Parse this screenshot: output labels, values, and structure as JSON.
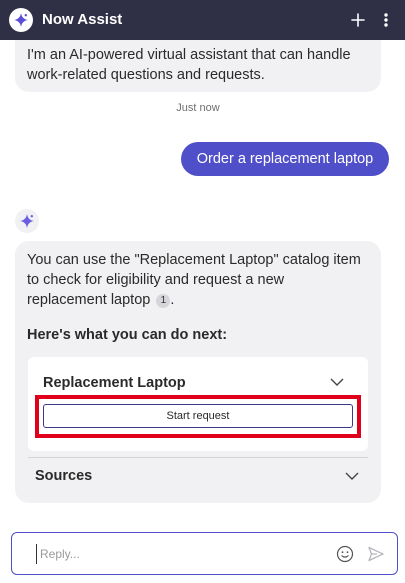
{
  "header": {
    "title": "Now Assist",
    "logo_icon": "sparkle-icon",
    "new_icon": "plus-icon",
    "more_icon": "more-vertical-icon",
    "background": "#2f2f46"
  },
  "messages": {
    "intro_text": "I'm an AI-powered virtual assistant that can handle work-related questions and requests.",
    "timestamp": "Just now",
    "user_message": "Order a replacement laptop",
    "assistant": {
      "icon": "sparkle-icon",
      "text": "You can use the \"Replacement Laptop\" catalog item to check for eligibility and request a new replacement laptop",
      "citation": "1",
      "next_heading": "Here's what you can do next:",
      "card": {
        "title": "Replacement Laptop",
        "action_label": "Start request"
      },
      "sources_label": "Sources"
    }
  },
  "input": {
    "placeholder": "Reply...",
    "value": "",
    "emoji_icon": "emoji-icon",
    "send_icon": "send-icon"
  },
  "colors": {
    "accent": "#4f4fc9",
    "bubble": "#f1f1f3",
    "highlight": "#e0001b"
  }
}
